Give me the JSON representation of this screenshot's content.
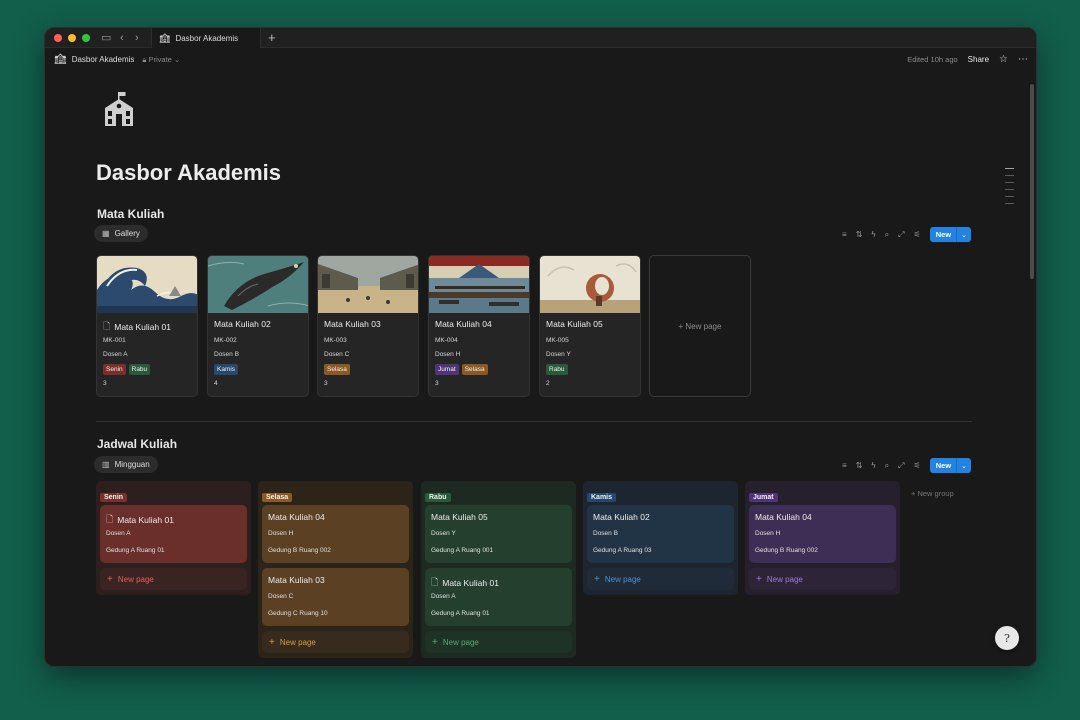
{
  "window": {
    "tab_title": "Dasbor Akademis",
    "tab_icon": "school-icon"
  },
  "topbar": {
    "breadcrumb_title": "Dasbor Akademis",
    "privacy": "Private",
    "edited": "Edited 10h ago",
    "share_label": "Share"
  },
  "page": {
    "title": "Dasbor Akademis",
    "icon": "school-icon"
  },
  "gallery": {
    "title": "Mata Kuliah",
    "view_label": "Gallery",
    "new_label": "New",
    "new_page_label": "+ New page",
    "cards": [
      {
        "name": "Mata Kuliah 01",
        "code": "MK-001",
        "dosen": "Dosen A",
        "tags": [
          "Senin",
          "Rabu"
        ],
        "sks": "3",
        "has_doc_icon": true
      },
      {
        "name": "Mata Kuliah 02",
        "code": "MK-002",
        "dosen": "Dosen B",
        "tags": [
          "Kamis"
        ],
        "sks": "4",
        "has_doc_icon": false
      },
      {
        "name": "Mata Kuliah 03",
        "code": "MK-003",
        "dosen": "Dosen C",
        "tags": [
          "Selasa"
        ],
        "sks": "3",
        "has_doc_icon": false
      },
      {
        "name": "Mata Kuliah 04",
        "code": "MK-004",
        "dosen": "Dosen H",
        "tags": [
          "Jumat",
          "Selasa"
        ],
        "sks": "3",
        "has_doc_icon": false
      },
      {
        "name": "Mata Kuliah 05",
        "code": "MK-005",
        "dosen": "Dosen Y",
        "tags": [
          "Rabu"
        ],
        "sks": "2",
        "has_doc_icon": false
      }
    ]
  },
  "board": {
    "title": "Jadwal Kuliah",
    "view_label": "Mingguan",
    "new_label": "New",
    "new_group_label": "+ New group",
    "new_page_label": "New page",
    "columns": [
      {
        "name": "Senin",
        "cards": [
          {
            "name": "Mata Kuliah 01",
            "dosen": "Dosen A",
            "room": "Gedung A Ruang 01"
          }
        ]
      },
      {
        "name": "Selasa",
        "cards": [
          {
            "name": "Mata Kuliah 04",
            "dosen": "Dosen H",
            "room": "Gedung B Ruang 002"
          },
          {
            "name": "Mata Kuliah 03",
            "dosen": "Dosen C",
            "room": "Gedung C Ruang 10"
          }
        ]
      },
      {
        "name": "Rabu",
        "cards": [
          {
            "name": "Mata Kuliah 05",
            "dosen": "Dosen Y",
            "room": "Gedung A Ruang 001"
          },
          {
            "name": "Mata Kuliah 01",
            "dosen": "Dosen A",
            "room": "Gedung A Ruang 01"
          }
        ]
      },
      {
        "name": "Kamis",
        "cards": [
          {
            "name": "Mata Kuliah 02",
            "dosen": "Dosen B",
            "room": "Gedung A Ruang 03"
          }
        ]
      },
      {
        "name": "Jumat",
        "cards": [
          {
            "name": "Mata Kuliah 04",
            "dosen": "Dosen H",
            "room": "Gedung B Ruang 002"
          }
        ]
      }
    ]
  },
  "colors": {
    "accent": "#2383e2",
    "background": "#191919",
    "desktop": "#125f4c"
  }
}
